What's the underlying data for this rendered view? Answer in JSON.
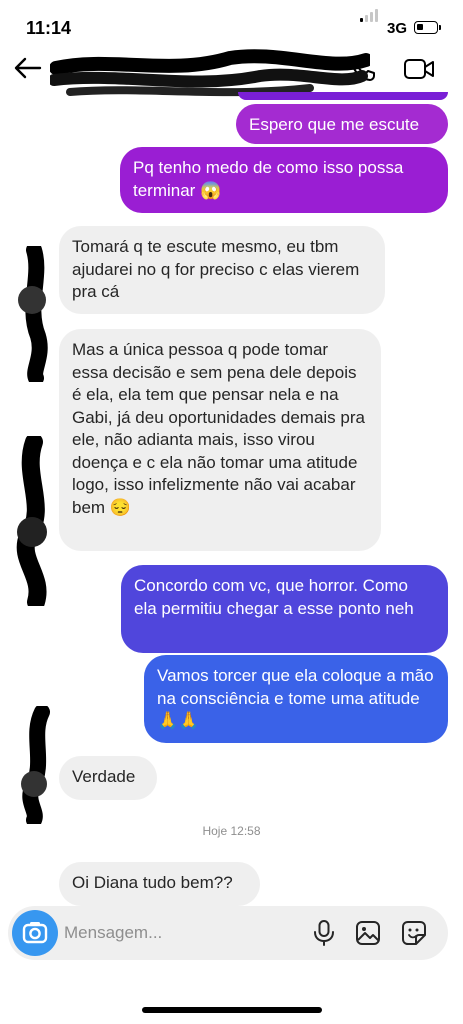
{
  "status": {
    "time": "11:14",
    "network": "3G"
  },
  "header": {
    "back_icon": "arrow-left-icon",
    "call_icon": "phone-icon",
    "video_icon": "video-camera-icon"
  },
  "messages": [
    {
      "dir": "out",
      "text": "Espero que me escute",
      "color": "#a42bd1"
    },
    {
      "dir": "out",
      "text": "Pq tenho medo de como isso possa terminar 😱",
      "color": "#9a1ed3"
    },
    {
      "dir": "in",
      "text": "Tomará q te escute mesmo, eu tbm ajudarei no q for preciso c elas vierem pra cá"
    },
    {
      "dir": "in",
      "text": "Mas a única pessoa q pode tomar essa decisão e sem pena dele depois é ela, ela tem que pensar nela e na Gabi, já deu oportunidades demais pra ele, não adianta mais, isso virou doença e c ela não tomar uma atitude logo, isso infelizmente não vai acabar bem 😔"
    },
    {
      "dir": "out",
      "text": "Concordo com vc, que horror. Como ela permitiu chegar a esse ponto neh",
      "color": "#5046dc"
    },
    {
      "dir": "out",
      "text": "Vamos torcer que ela coloque a mão na consciência e tome uma atitude 🙏🙏",
      "color": "#3a62e8"
    },
    {
      "dir": "in",
      "text": "Verdade"
    },
    {
      "dir": "in",
      "text": "Oi Diana tudo bem??"
    }
  ],
  "timestamp": "Hoje 12:58",
  "composer": {
    "placeholder": "Mensagem...",
    "camera_icon": "camera-icon",
    "mic_icon": "microphone-icon",
    "gallery_icon": "image-icon",
    "sticker_icon": "sticker-icon",
    "accent": "#3797f0"
  }
}
